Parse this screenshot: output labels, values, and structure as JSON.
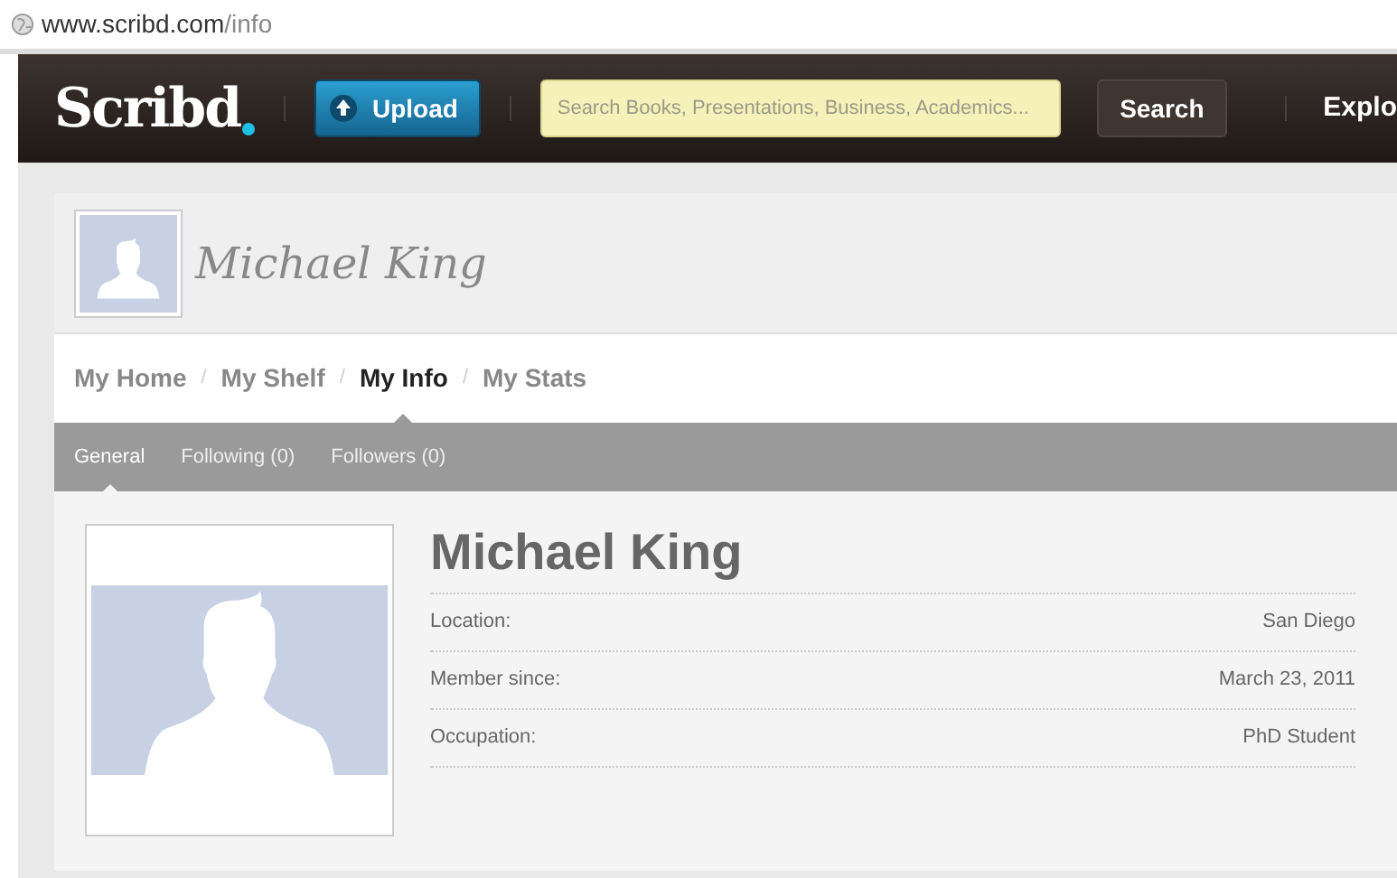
{
  "address_bar": {
    "host": "www.scribd.com",
    "path": "/info"
  },
  "header": {
    "logo": "Scribd",
    "upload_button": "Upload",
    "search": {
      "placeholder": "Search Books, Presentations, Business, Academics..."
    },
    "search_button": "Search",
    "explore": "Explo"
  },
  "profile_header": {
    "name": "Michael King"
  },
  "nav": [
    {
      "label": "My Home",
      "selected": false
    },
    {
      "separator": "/",
      "label": "My Shelf",
      "selected": false
    },
    {
      "separator": "/",
      "label": "My Info",
      "selected": true
    },
    {
      "separator": "/",
      "label": "My Stats",
      "selected": false
    }
  ],
  "subnav": [
    {
      "label": "General",
      "selected": true
    },
    {
      "label": "Following (0)",
      "selected": false
    },
    {
      "label": "Followers (0)",
      "selected": false
    }
  ],
  "profile": {
    "name": "Michael King",
    "fields": [
      {
        "label": "Location:",
        "value": "San Diego"
      },
      {
        "label": "Member since:",
        "value": "March 23, 2011"
      },
      {
        "label": "Occupation:",
        "value": "PhD Student"
      }
    ]
  }
}
